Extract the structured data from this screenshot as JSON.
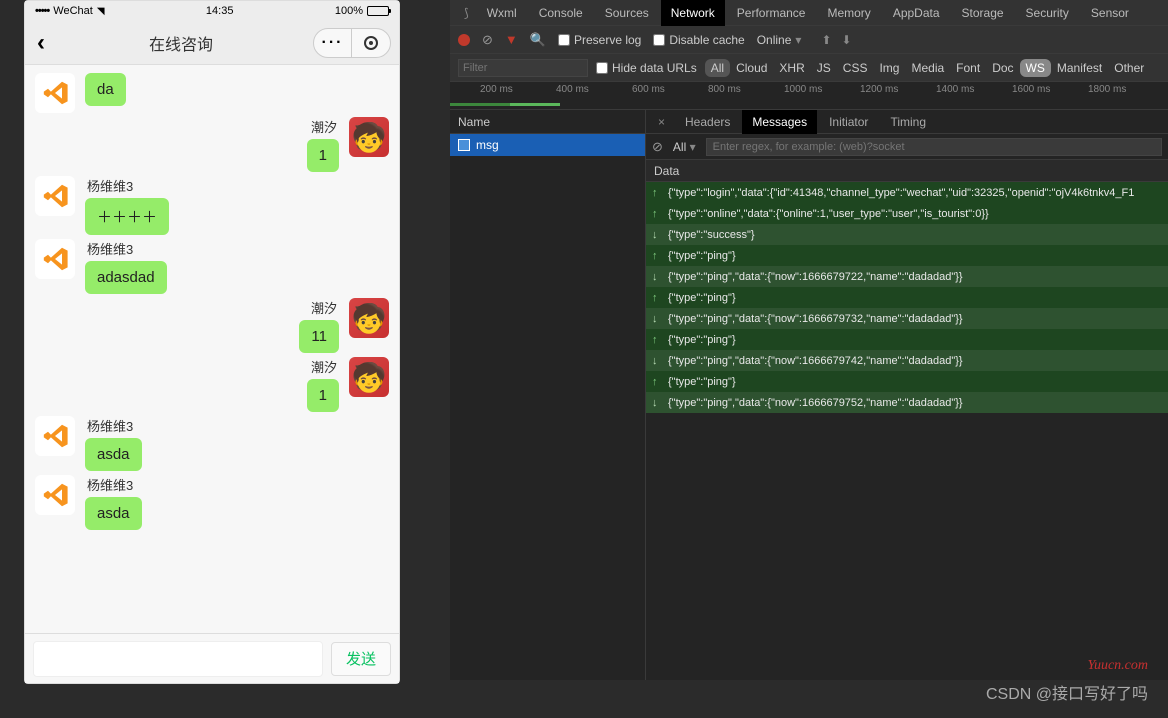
{
  "phone": {
    "carrier": "WeChat",
    "time": "14:35",
    "battery_pct": "100%",
    "title": "在线咨询",
    "send_label": "发送",
    "messages": [
      {
        "side": "left",
        "name": "",
        "text": "da",
        "avatar": "vscode",
        "show_avatar": true
      },
      {
        "side": "right",
        "name": "潮汐",
        "text": "1",
        "avatar": "user",
        "show_avatar": true
      },
      {
        "side": "left",
        "name": "杨维维3",
        "text": "＋＋＋＋",
        "avatar": "vscode",
        "show_avatar": true
      },
      {
        "side": "left",
        "name": "杨维维3",
        "text": "adasdad",
        "avatar": "vscode",
        "show_avatar": true
      },
      {
        "side": "right",
        "name": "潮汐",
        "text": "11",
        "avatar": "user",
        "show_avatar": true
      },
      {
        "side": "right",
        "name": "潮汐",
        "text": "1",
        "avatar": "user",
        "show_avatar": true
      },
      {
        "side": "left",
        "name": "杨维维3",
        "text": "asda",
        "avatar": "vscode",
        "show_avatar": true
      },
      {
        "side": "left",
        "name": "杨维维3",
        "text": "asda",
        "avatar": "vscode",
        "show_avatar": true
      }
    ]
  },
  "devtools": {
    "tabs": [
      "Wxml",
      "Console",
      "Sources",
      "Network",
      "Performance",
      "Memory",
      "AppData",
      "Storage",
      "Security",
      "Sensor"
    ],
    "active_tab": "Network",
    "preserve_label": "Preserve log",
    "disable_cache_label": "Disable cache",
    "online_label": "Online",
    "filter_placeholder": "Filter",
    "hide_data_urls": "Hide data URLs",
    "type_pills": [
      "All",
      "Cloud",
      "XHR",
      "JS",
      "CSS",
      "Img",
      "Media",
      "Font",
      "Doc",
      "WS",
      "Manifest",
      "Other"
    ],
    "timeline_ticks": [
      "200 ms",
      "400 ms",
      "600 ms",
      "800 ms",
      "1000 ms",
      "1200 ms",
      "1400 ms",
      "1600 ms",
      "1800 ms"
    ],
    "name_header": "Name",
    "requests": [
      {
        "name": "msg"
      }
    ],
    "detail_tabs": [
      "Headers",
      "Messages",
      "Initiator",
      "Timing"
    ],
    "detail_active": "Messages",
    "msg_filter_all": "All",
    "regex_placeholder": "Enter regex, for example: (web)?socket",
    "data_header": "Data",
    "frames": [
      {
        "dir": "up",
        "text": "{\"type\":\"login\",\"data\":{\"id\":41348,\"channel_type\":\"wechat\",\"uid\":32325,\"openid\":\"ojV4k6tnkv4_F1"
      },
      {
        "dir": "up",
        "text": "{\"type\":\"online\",\"data\":{\"online\":1,\"user_type\":\"user\",\"is_tourist\":0}}"
      },
      {
        "dir": "down",
        "text": "{\"type\":\"success\"}"
      },
      {
        "dir": "up",
        "text": "{\"type\":\"ping\"}"
      },
      {
        "dir": "down",
        "text": "{\"type\":\"ping\",\"data\":{\"now\":1666679722,\"name\":\"dadadad\"}}"
      },
      {
        "dir": "up",
        "text": "{\"type\":\"ping\"}"
      },
      {
        "dir": "down",
        "text": "{\"type\":\"ping\",\"data\":{\"now\":1666679732,\"name\":\"dadadad\"}}"
      },
      {
        "dir": "up",
        "text": "{\"type\":\"ping\"}"
      },
      {
        "dir": "down",
        "text": "{\"type\":\"ping\",\"data\":{\"now\":1666679742,\"name\":\"dadadad\"}}"
      },
      {
        "dir": "up",
        "text": "{\"type\":\"ping\"}"
      },
      {
        "dir": "down",
        "text": "{\"type\":\"ping\",\"data\":{\"now\":1666679752,\"name\":\"dadadad\"}}"
      }
    ]
  },
  "watermark": "Yuucn.com",
  "csdn": "CSDN @接口写好了吗"
}
